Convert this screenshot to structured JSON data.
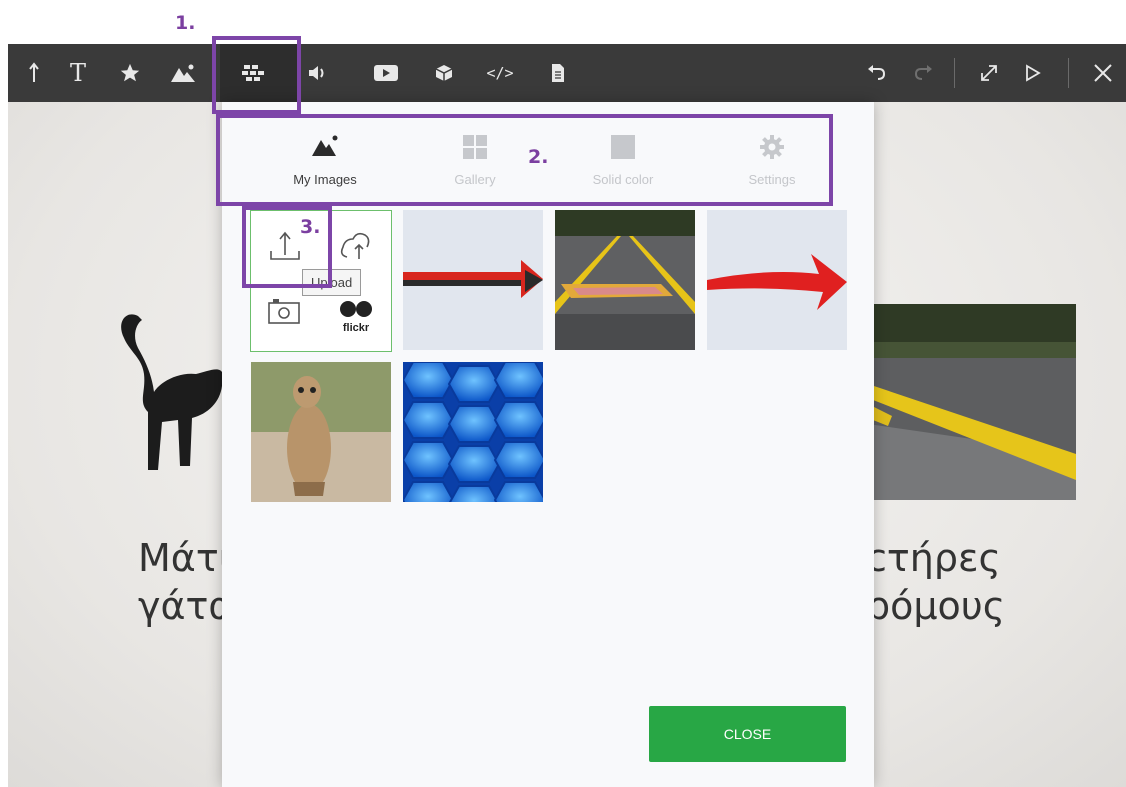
{
  "annotations": {
    "one": "1.",
    "two": "2.",
    "three": "3."
  },
  "toolbar": {
    "icons": [
      "upload-icon",
      "text-icon",
      "star-icon",
      "image-icon",
      "background-icon",
      "audio-icon",
      "video-icon",
      "3d-object-icon",
      "embed-code-icon",
      "document-icon",
      "undo-icon",
      "redo-icon",
      "fullscreen-icon",
      "play-icon",
      "close-icon"
    ],
    "text_icon_label": "T",
    "embed_label": "</>",
    "colors": {
      "bar": "#3a3a3a",
      "icon": "#e8e8e8"
    }
  },
  "slide": {
    "left_text_line1": "Μάτι",
    "left_text_line2": "γάτα",
    "right_text_line1": "ϲτήρες",
    "right_text_line2": "ρόμους"
  },
  "dialog": {
    "tabs": [
      {
        "label": "My Images",
        "icon": "mountain-image-icon",
        "active": true
      },
      {
        "label": "Gallery",
        "icon": "grid-icon",
        "active": false
      },
      {
        "label": "Solid color",
        "icon": "square-icon",
        "active": false
      },
      {
        "label": "Settings",
        "icon": "gear-icon",
        "active": false
      }
    ],
    "upload_tooltip": "Upload",
    "flickr_label": "flickr",
    "images": [
      "red-arrow-right",
      "road-yellow-lines",
      "red-curved-arrow",
      "meerkat",
      "blue-hexagons"
    ],
    "close_label": "CLOSE",
    "colors": {
      "close": "#28a745",
      "annotation": "#7d45a8",
      "upload_border": "#6cbf6c"
    }
  }
}
